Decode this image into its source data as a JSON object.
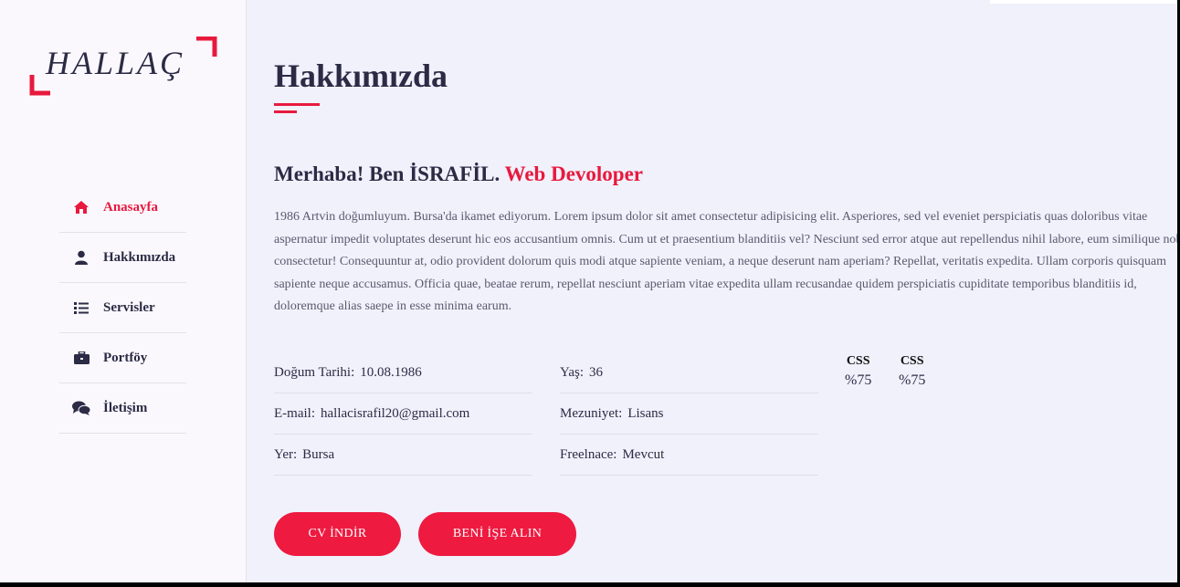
{
  "brand": {
    "logo_text": "HALLAÇ",
    "accent_color": "#e8193e",
    "text_color": "#2b2b45"
  },
  "sidebar": {
    "items": [
      {
        "label": "Anasayfa",
        "icon": "home-icon",
        "active": true
      },
      {
        "label": "Hakkımızda",
        "icon": "user-icon",
        "active": false
      },
      {
        "label": "Servisler",
        "icon": "list-icon",
        "active": false
      },
      {
        "label": "Portföy",
        "icon": "briefcase-icon",
        "active": false
      },
      {
        "label": "İletişim",
        "icon": "comments-icon",
        "active": false
      }
    ]
  },
  "main": {
    "title": "Hakkımızda",
    "greeting_prefix": "Merhaba! Ben İSRAFİL.",
    "greeting_role": "Web Devoloper",
    "bio": "1986 Artvin doğumluyum. Bursa'da ikamet ediyorum. Lorem ipsum dolor sit amet consectetur adipisicing elit. Asperiores, sed vel eveniet perspiciatis quas doloribus vitae aspernatur impedit voluptates deserunt hic eos accusantium omnis. Cum ut et praesentium blanditiis vel? Nesciunt sed error atque aut repellendus nihil labore, eum similique nobis consectetur! Consequuntur at, odio provident dolorum quis modi atque sapiente veniam, a neque deserunt nam aperiam? Repellat, veritatis expedita. Ullam corporis quisquam sapiente neque accusamus. Officia quae, beatae rerum, repellat nesciunt aperiam vitae expedita ullam recusandae quidem perspiciatis cupiditate temporibus blanditiis id, doloremque alias saepe in esse minima earum.",
    "info_left": [
      {
        "label": "Doğum Tarihi:",
        "value": "10.08.1986"
      },
      {
        "label": "E-mail:",
        "value": "hallacisrafil20@gmail.com"
      },
      {
        "label": "Yer:",
        "value": "Bursa"
      }
    ],
    "info_right": [
      {
        "label": "Yaş:",
        "value": "36"
      },
      {
        "label": "Mezuniyet:",
        "value": "Lisans"
      },
      {
        "label": "Freelnace:",
        "value": "Mevcut"
      }
    ],
    "skills": [
      {
        "name": "CSS",
        "value": "%75"
      },
      {
        "name": "CSS",
        "value": "%75"
      }
    ],
    "buttons": {
      "cv": "CV İNDİR",
      "hire": "BENİ İŞE ALIN"
    }
  }
}
